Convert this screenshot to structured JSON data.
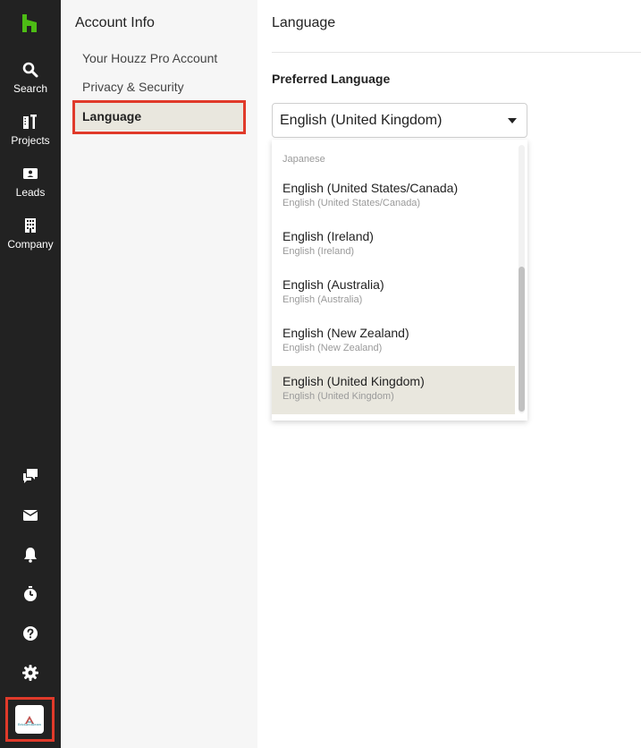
{
  "colors": {
    "leftnav_bg": "#222222",
    "brand_green": "#4dbc15",
    "highlight_red": "#e03a2a",
    "selected_bg": "#e9e7de"
  },
  "leftnav": {
    "logo_icon": "houzz-logo-icon",
    "items": [
      {
        "label": "Search",
        "icon": "search-icon"
      },
      {
        "label": "Projects",
        "icon": "projects-icon"
      },
      {
        "label": "Leads",
        "icon": "leads-icon"
      },
      {
        "label": "Company",
        "icon": "company-icon"
      }
    ],
    "bottom_icons": [
      "messages-icon",
      "inbox-icon",
      "bell-icon",
      "timer-icon",
      "help-icon",
      "gear-icon"
    ],
    "avatar_text": "BrickandBeam"
  },
  "subnav": {
    "title": "Account Info",
    "items": [
      {
        "label": "Your Houzz Pro Account"
      },
      {
        "label": "Privacy & Security"
      },
      {
        "label": "Language"
      }
    ]
  },
  "main": {
    "title": "Language",
    "field_label": "Preferred Language",
    "selected_value": "English (United Kingdom)",
    "options": [
      {
        "primary": "",
        "secondary": "Japanese"
      },
      {
        "primary": "English (United States/Canada)",
        "secondary": "English (United States/Canada)"
      },
      {
        "primary": "English (Ireland)",
        "secondary": "English (Ireland)"
      },
      {
        "primary": "English (Australia)",
        "secondary": "English (Australia)"
      },
      {
        "primary": "English (New Zealand)",
        "secondary": "English (New Zealand)"
      },
      {
        "primary": "English (United Kingdom)",
        "secondary": "English (United Kingdom)"
      }
    ]
  }
}
